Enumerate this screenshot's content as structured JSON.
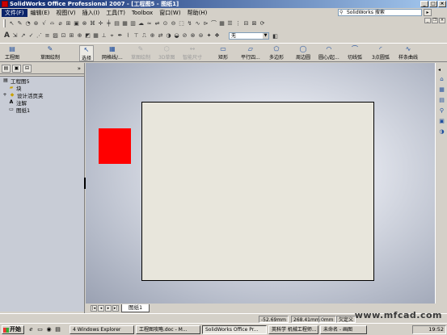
{
  "window": {
    "title": "SolidWorks Office Professional 2007 - [工程图5 - 图纸1]"
  },
  "menu": [
    "文件(F)",
    "编辑(E)",
    "视图(V)",
    "插入(I)",
    "工具(T)",
    "Toolbox",
    "窗口(W)",
    "帮助(H)"
  ],
  "search": {
    "text": "SolidWorks 搜索"
  },
  "toolbar2": {
    "layer_select": "无"
  },
  "command_manager": {
    "groups": [
      "工程图",
      "草图绘制"
    ],
    "commands": [
      "选择",
      "网格线/...",
      "草图绘制",
      "3D草图",
      "智能尺寸",
      "矩形",
      "平行四...",
      "多边形",
      "周边圆",
      "圆心/起...",
      "切线弧",
      "3点圆弧",
      "样条曲线"
    ]
  },
  "feature_tree": {
    "items": [
      "工程图5",
      "块",
      "设计活页夹",
      "注解",
      "图纸1"
    ]
  },
  "sheet_tabs": {
    "active": "图纸1"
  },
  "status": {
    "x": "-52.69mm",
    "y": "268.41mm",
    "z": "0mm",
    "state": "欠定义",
    "watermark": "www.mfcad.com"
  },
  "taskbar": {
    "start": "开始",
    "tasks": [
      "4 Windows Explorer",
      "工程图攻略.doc - M...",
      "SolidWorks Office Pr...",
      "英科学 机械工程师...",
      "未命名 - 画图"
    ],
    "clock": "19:52"
  }
}
